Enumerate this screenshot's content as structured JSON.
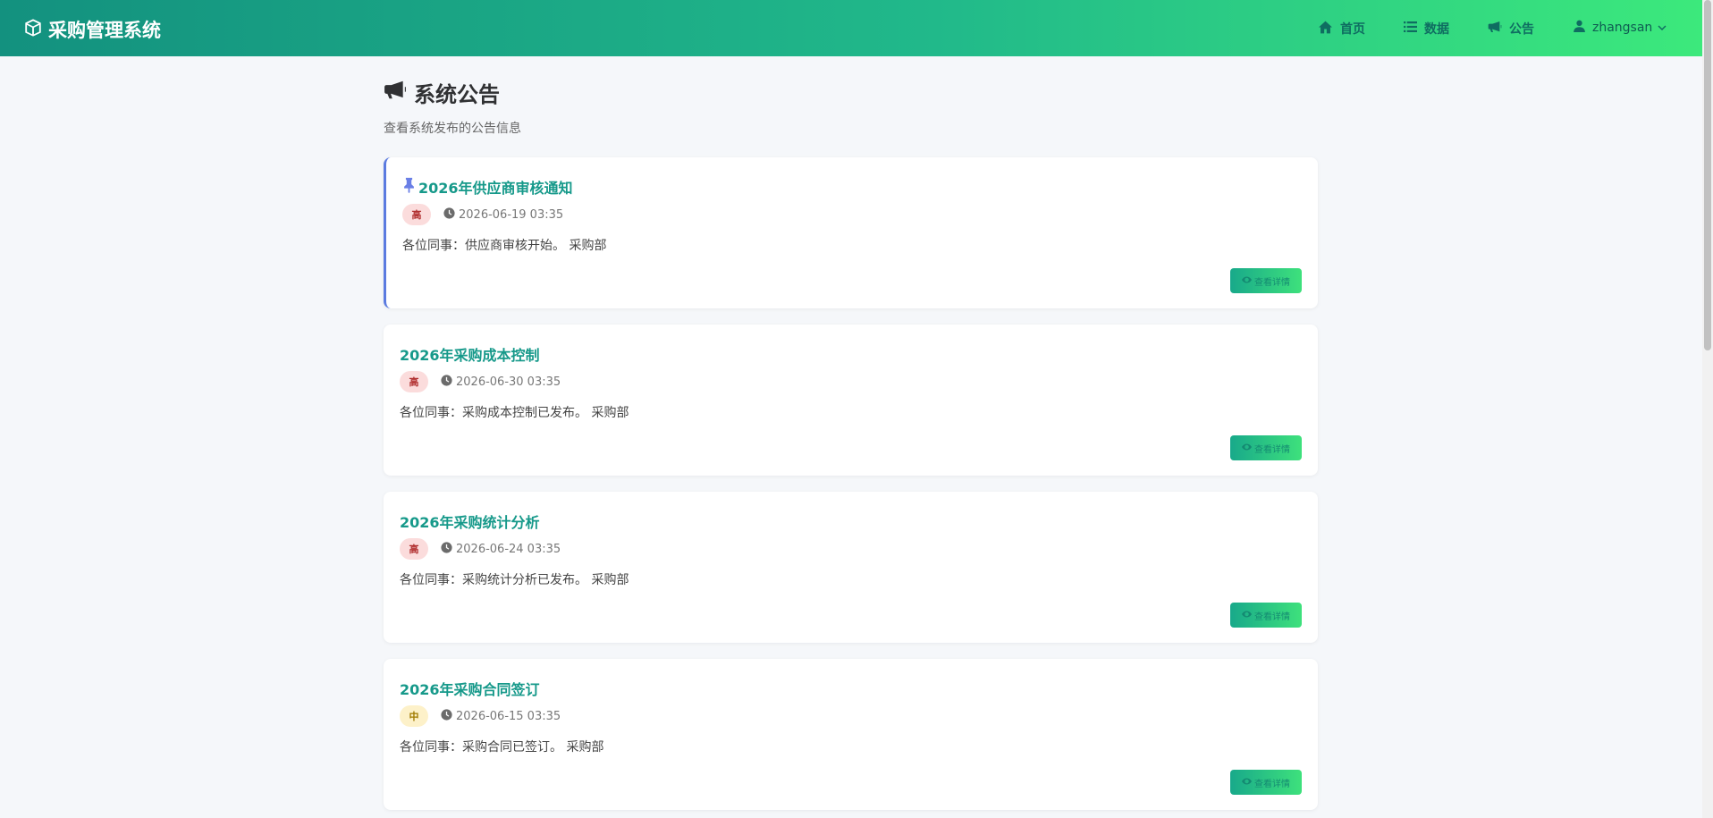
{
  "header": {
    "brand": "采购管理系统",
    "nav": [
      {
        "label": "首页",
        "icon": "home-icon"
      },
      {
        "label": "数据",
        "icon": "list-icon"
      },
      {
        "label": "公告",
        "icon": "megaphone-icon"
      }
    ],
    "user": {
      "name": "zhangsan",
      "icon": "user-icon"
    }
  },
  "page": {
    "title": "系统公告",
    "subtitle": "查看系统发布的公告信息"
  },
  "announcements": [
    {
      "title": "2026年供应商审核通知",
      "pinned": true,
      "priority": "高",
      "priority_level": "high",
      "date": "2026-06-19 03:35",
      "content": "各位同事：供应商审核开始。 采购部",
      "button": "查看详情"
    },
    {
      "title": "2026年采购成本控制",
      "pinned": false,
      "priority": "高",
      "priority_level": "high",
      "date": "2026-06-30 03:35",
      "content": "各位同事：采购成本控制已发布。 采购部",
      "button": "查看详情"
    },
    {
      "title": "2026年采购统计分析",
      "pinned": false,
      "priority": "高",
      "priority_level": "high",
      "date": "2026-06-24 03:35",
      "content": "各位同事：采购统计分析已发布。 采购部",
      "button": "查看详情"
    },
    {
      "title": "2026年采购合同签订",
      "pinned": false,
      "priority": "中",
      "priority_level": "mid",
      "date": "2026-06-15 03:35",
      "content": "各位同事：采购合同已签订。 采购部",
      "button": "查看详情"
    }
  ],
  "colors": {
    "header_gradient_start": "#13917f",
    "header_gradient_end": "#3ce97c",
    "title_accent": "#16998a",
    "pinned_border": "#5b7be0",
    "badge_high_bg": "#fbdcdc",
    "badge_mid_bg": "#fdf1c9"
  }
}
